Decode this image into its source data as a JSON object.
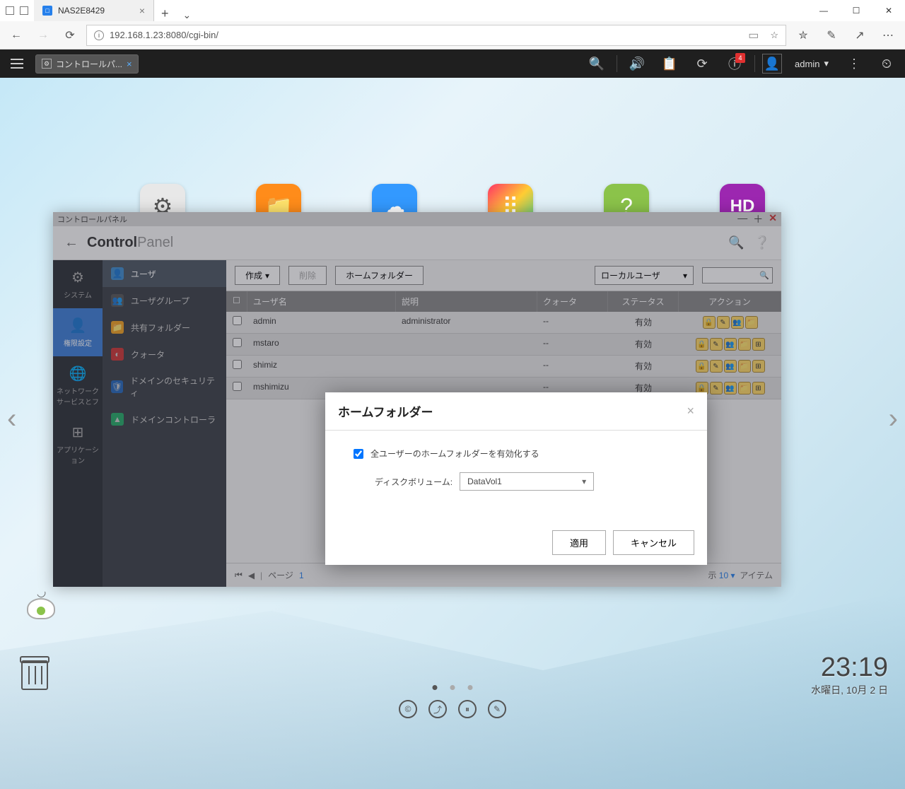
{
  "browser": {
    "tab_title": "NAS2E8429",
    "url": "192.168.1.23:8080/cgi-bin/"
  },
  "nas_topbar": {
    "app_pill": "コントロールパ...",
    "notification_badge": "4",
    "user": "admin"
  },
  "cp_window_title": "コントロールパネル",
  "cp_title_bold": "Control",
  "cp_title_light": "Panel",
  "cp_nav": {
    "system": "システム",
    "privileges": "権限設定",
    "network": "ネットワークサービスとフ",
    "application": "アプリケーション"
  },
  "cp_subnav": {
    "user": "ユーザ",
    "user_group": "ユーザグループ",
    "shared_folder": "共有フォルダー",
    "quota": "クォータ",
    "domain_sec": "ドメインのセキュリティ",
    "domain_ctrl": "ドメインコントローラ"
  },
  "toolbar": {
    "create": "作成",
    "delete": "削除",
    "home_folder": "ホームフォルダー",
    "user_type": "ローカルユーザ"
  },
  "table": {
    "col_name": "ユーザ名",
    "col_desc": "説明",
    "col_quota": "クォータ",
    "col_status": "ステータス",
    "col_action": "アクション",
    "rows": [
      {
        "name": "admin",
        "desc": "administrator",
        "quota": "--",
        "status": "有効"
      },
      {
        "name": "mstaro",
        "desc": "",
        "quota": "--",
        "status": "有効"
      },
      {
        "name": "shimiz",
        "desc": "",
        "quota": "--",
        "status": "有効"
      },
      {
        "name": "mshimizu",
        "desc": "",
        "quota": "--",
        "status": "有効"
      }
    ]
  },
  "pager": {
    "page_label": "ページ",
    "page_num": "1",
    "display_count": "10",
    "items_label": "アイテム",
    "display_prefix": "示"
  },
  "modal": {
    "title": "ホームフォルダー",
    "enable_label": "全ユーザーのホームフォルダーを有効化する",
    "disk_label": "ディスクボリューム:",
    "disk_value": "DataVol1",
    "apply": "適用",
    "cancel": "キャンセル"
  },
  "clock": {
    "time": "23:19",
    "date": "水曜日, 10月 2 日"
  }
}
